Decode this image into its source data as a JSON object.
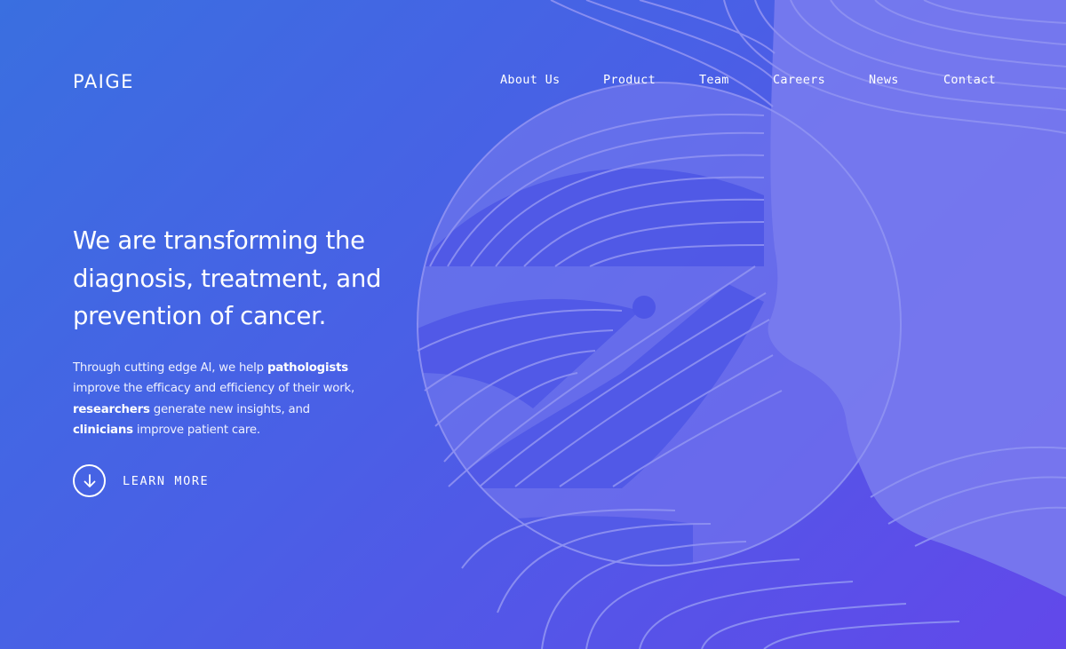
{
  "brand": {
    "logo": "PAIGE"
  },
  "nav": {
    "items": [
      {
        "label": "About Us"
      },
      {
        "label": "Product"
      },
      {
        "label": "Team"
      },
      {
        "label": "Careers"
      },
      {
        "label": "News"
      },
      {
        "label": "Contact"
      }
    ]
  },
  "hero": {
    "headline_lines": [
      "We are transforming the",
      "diagnosis, treatment, and",
      "prevention of cancer."
    ],
    "intro": [
      {
        "text": "Through cutting edge AI, we help ",
        "bold": false
      },
      {
        "text": "pathologists",
        "bold": true
      },
      {
        "text": " improve the efficacy and efficiency of their work, ",
        "bold": false
      },
      {
        "text": "researchers",
        "bold": true
      },
      {
        "text": " generate new insights, and ",
        "bold": false
      },
      {
        "text": "clinicians",
        "bold": true
      },
      {
        "text": " improve patient care.",
        "bold": false
      }
    ],
    "cta": {
      "label": "LEARN MORE",
      "icon": "arrow-down-icon"
    }
  },
  "illustration": {
    "icon": "profile-illustration",
    "colors": {
      "light_fill": "#7a7cef",
      "stroke": "#8f92f2",
      "dark_fill": "#4e56e6"
    }
  },
  "colors": {
    "gradient_start": "#3a6fe0",
    "gradient_end": "#6248ea",
    "text": "#ffffff"
  }
}
